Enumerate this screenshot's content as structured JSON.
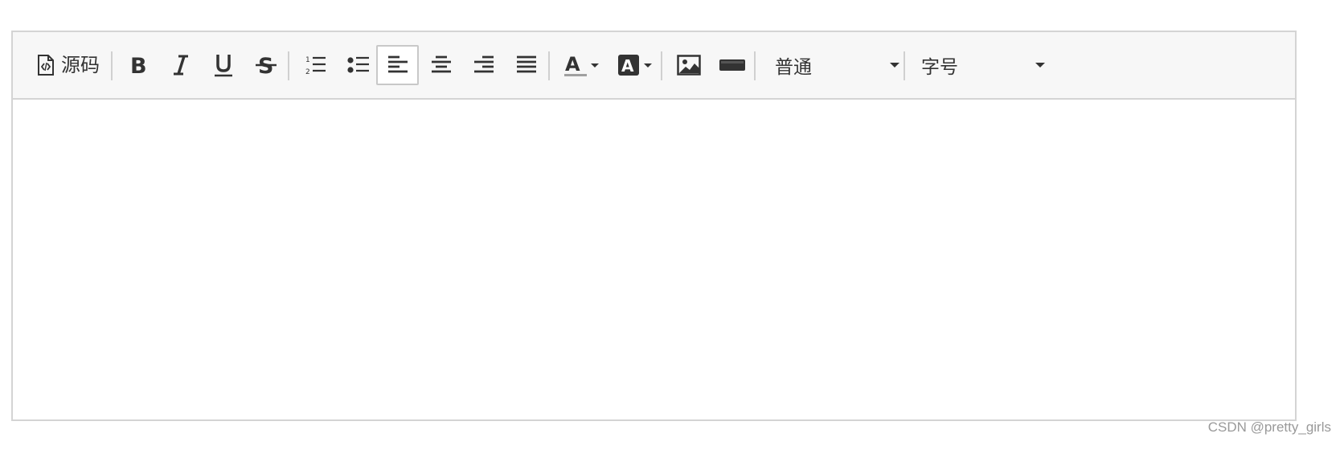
{
  "toolbar": {
    "source_label": "源码",
    "block_format": {
      "selected": "普通"
    },
    "font_size": {
      "placeholder": "字号"
    },
    "buttons": [
      {
        "id": "bold",
        "title": "Bold"
      },
      {
        "id": "italic",
        "title": "Italic"
      },
      {
        "id": "underline",
        "title": "Underline"
      },
      {
        "id": "strikethrough",
        "title": "Strikethrough"
      },
      {
        "id": "ordered-list",
        "title": "Ordered list"
      },
      {
        "id": "bullet-list",
        "title": "Bullet list"
      },
      {
        "id": "align-left",
        "title": "Align left",
        "active": true
      },
      {
        "id": "align-center",
        "title": "Align center"
      },
      {
        "id": "align-right",
        "title": "Align right"
      },
      {
        "id": "justify",
        "title": "Justify"
      },
      {
        "id": "font-color",
        "title": "Font color"
      },
      {
        "id": "background-color",
        "title": "Background color"
      },
      {
        "id": "image",
        "title": "Image"
      },
      {
        "id": "horizontal-rule",
        "title": "Horizontal rule"
      }
    ]
  },
  "content": {
    "text": ""
  },
  "watermark": "CSDN @pretty_girls",
  "colors": {
    "toolbar_bg": "#f7f7f7",
    "border": "#d4d4d4",
    "icon": "#333333",
    "font_color_underline": "#a0a0a0"
  }
}
